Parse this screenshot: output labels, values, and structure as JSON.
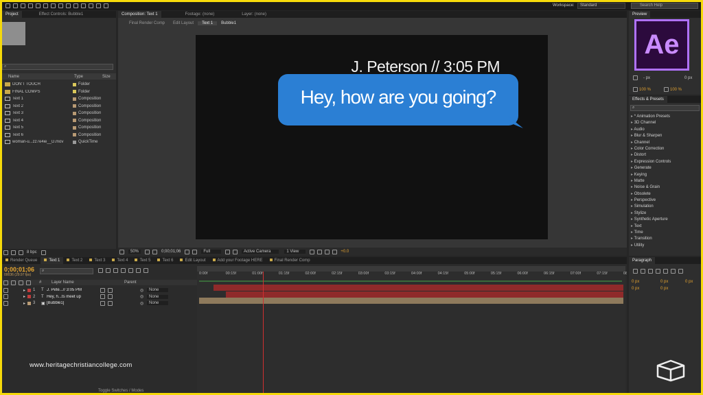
{
  "menu": {
    "workspace_label": "Workspace:",
    "workspace_value": "Standard",
    "search_placeholder": "Search Help"
  },
  "project": {
    "tab": "Project",
    "effect_controls_tab": "Effect Controls: Bubble1",
    "search_glyph": "⌕",
    "col_name": "Name",
    "col_type": "Type",
    "col_size": "Size",
    "bpc": "8 bpc",
    "items": [
      {
        "name": "DON'T TOUCH",
        "type": "Folder",
        "kind": "folder",
        "color": "#d9c75a"
      },
      {
        "name": "FINAL COMPS",
        "type": "Folder",
        "kind": "folder",
        "color": "#d9c75a"
      },
      {
        "name": "Text 1",
        "type": "Composition",
        "kind": "comp",
        "color": "#b89a74"
      },
      {
        "name": "Text 2",
        "type": "Composition",
        "kind": "comp",
        "color": "#b89a74"
      },
      {
        "name": "Text 3",
        "type": "Composition",
        "kind": "comp",
        "color": "#b89a74"
      },
      {
        "name": "Text 4",
        "type": "Composition",
        "kind": "comp",
        "color": "#b89a74"
      },
      {
        "name": "Text 5",
        "type": "Composition",
        "kind": "comp",
        "color": "#b89a74"
      },
      {
        "name": "Text 6",
        "type": "Composition",
        "kind": "comp",
        "color": "#b89a74"
      },
      {
        "name": "woman-u...zz7e4ie__D.mov",
        "type": "QuickTime",
        "kind": "file",
        "color": "#9a9a9a"
      }
    ]
  },
  "comp": {
    "tab": "Composition: Text 1",
    "footage_tab": "Footage: (none)",
    "layer_tab": "Layer: (none)",
    "breadcrumbs": [
      "Final Render Comp",
      "Edit Layout",
      "Text 1",
      "Bubble1"
    ],
    "header_text": "J. Peterson  // 3:05 PM",
    "bubble_text": "Hey, how are you going?",
    "bubble_color": "#2b7fd4",
    "footer": {
      "zoom": "50%",
      "timecode": "0;00;01;06",
      "resolution": "Full",
      "camera": "Active Camera",
      "view": "1 View",
      "exposure": "+0.0"
    }
  },
  "preview": {
    "tab": "Preview",
    "ae_logo": "Ae",
    "px1": "- px",
    "px2": "0 px",
    "scale_v": "100 %",
    "scale_h": "100 %"
  },
  "effects": {
    "tab": "Effects & Presets",
    "search_glyph": "⌕",
    "items": [
      "* Animation Presets",
      "3D Channel",
      "Audio",
      "Blur & Sharpen",
      "Channel",
      "Color Correction",
      "Distort",
      "Expression Controls",
      "Generate",
      "Keying",
      "Matte",
      "Noise & Grain",
      "Obsolete",
      "Perspective",
      "Simulation",
      "Stylize",
      "Synthetic Aperture",
      "Text",
      "Time",
      "Transition",
      "Utility"
    ]
  },
  "timeline": {
    "tabs": [
      "Render Queue",
      "Text 1",
      "Text 2",
      "Text 3",
      "Text 4",
      "Text 5",
      "Text 6",
      "Edit Layout",
      "Add your Footage HERE",
      "Final Render Comp"
    ],
    "active_tab": "Text 1",
    "timecode": "0;00;01;06",
    "fps": "00036 (29.97 fps)",
    "search_glyph": "⌕",
    "col_num": "#",
    "col_layer": "Layer Name",
    "col_parent": "Parent",
    "ticks": [
      "0:00f",
      "00:15f",
      "01:00f",
      "01:15f",
      "02:00f",
      "02:15f",
      "03:00f",
      "03:15f",
      "04:00f",
      "04:15f",
      "05:00f",
      "05:15f",
      "06:00f",
      "06:15f",
      "07:00f",
      "07:15f",
      "08:0"
    ],
    "playhead_frames": 36,
    "total_frames": 240,
    "layers": [
      {
        "num": "1",
        "name": "J. Pete...// 3:05 PM",
        "kind": "T",
        "parent": "None",
        "color": "#c23c3c",
        "start": 8,
        "end": 240
      },
      {
        "num": "2",
        "name": "Hey, h...ts meet up",
        "kind": "T",
        "parent": "None",
        "color": "#c23c3c",
        "start": 15,
        "end": 240
      },
      {
        "num": "3",
        "name": "[Bubble1]",
        "kind": "comp",
        "parent": "None",
        "color": "#b89a74",
        "start": 0,
        "end": 240
      }
    ],
    "toggle": "Toggle Switches / Modes"
  },
  "paragraph": {
    "tab": "Paragraph",
    "fields": [
      "0 px",
      "0 px",
      "0 px",
      "0 px",
      "0 px"
    ]
  },
  "watermark": "www.heritagechristiancollege.com"
}
